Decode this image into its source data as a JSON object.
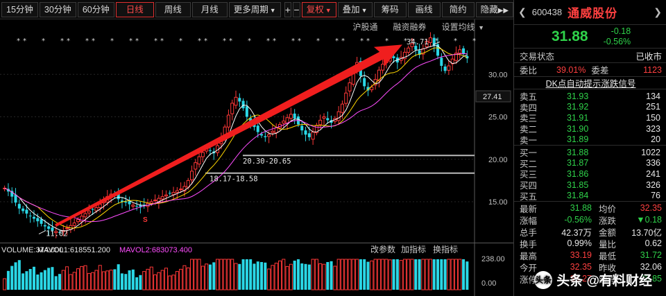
{
  "toolbar": {
    "periods": [
      "15分钟",
      "30分钟",
      "60分钟",
      "日线",
      "周线",
      "月线",
      "更多周期"
    ],
    "active_period": "日线",
    "tools": [
      "复权",
      "叠加",
      "筹码",
      "画线",
      "简约",
      "隐藏"
    ]
  },
  "subtools": [
    "沪股通",
    "融资融券",
    "设置均线"
  ],
  "chart_data": {
    "type": "candlestick",
    "y_ticks": [
      30.0,
      25.0,
      20.0,
      15.0
    ],
    "y_range": [
      11.0,
      35.0
    ],
    "current_price_label": "27.41",
    "annotations": {
      "low": "11.02",
      "high": "34.71",
      "band1": "20.30-20.65",
      "band2": "18.17-18.58"
    },
    "closes": [
      16.6,
      16.2,
      15.6,
      14.9,
      14.2,
      13.9,
      13.6,
      13.3,
      13.0,
      12.7,
      12.4,
      12.1,
      11.8,
      11.6,
      11.5,
      11.4,
      11.6,
      11.9,
      12.2,
      12.5,
      12.9,
      13.3,
      13.6,
      13.9,
      14.1,
      14.3,
      14.7,
      15.2,
      15.6,
      15.9,
      15.7,
      15.3,
      15.0,
      14.9,
      14.7,
      14.6,
      14.5,
      14.4,
      14.6,
      14.8,
      15.0,
      15.2,
      15.4,
      15.6,
      15.8,
      16.0,
      16.1,
      16.3,
      16.5,
      16.8,
      17.5,
      18.6,
      19.6,
      20.3,
      20.8,
      21.3,
      21.0,
      20.7,
      21.6,
      22.6,
      23.8,
      25.2,
      26.6,
      27.3,
      26.8,
      26.0,
      25.0,
      24.4,
      23.8,
      23.2,
      22.8,
      22.6,
      22.9,
      23.3,
      23.7,
      24.1,
      24.5,
      24.9,
      25.3,
      24.8,
      24.1,
      23.4,
      22.9,
      22.6,
      23.2,
      24.0,
      24.6,
      25.0,
      24.6,
      24.3,
      24.8,
      25.6,
      26.5,
      27.8,
      29.0,
      30.6,
      31.4,
      29.8,
      28.6,
      28.1,
      28.5,
      29.4,
      30.5,
      31.2,
      31.8,
      32.2,
      31.9,
      31.4,
      32.0,
      32.6,
      33.1,
      33.6,
      32.9,
      32.3,
      33.0,
      33.9,
      34.3,
      33.4,
      32.2,
      31.0,
      30.4,
      31.0,
      31.8,
      32.5,
      32.9,
      32.4,
      31.88
    ],
    "volume": {
      "y_ticks": [
        "238.00",
        "0.00"
      ],
      "legend": [
        "VOLUME:374.000",
        "MAVOL1:618551.200",
        "MAVOL2:683073.400"
      ],
      "right_links": [
        "改参数",
        "加指标",
        "换指标"
      ]
    }
  },
  "panel": {
    "code": "600438",
    "name": "通威股份",
    "price": "31.88",
    "change": "-0.18",
    "change_pct": "-0.56%",
    "trade_status_label": "交易状态",
    "trade_status": "已收市",
    "weibi_label": "委比",
    "weibi": "39.01%",
    "weicha_label": "委差",
    "weicha": "1123",
    "dk_label": "DK点自动提示涨跌信号",
    "asks": [
      {
        "name": "卖五",
        "price": "31.93",
        "vol": "134"
      },
      {
        "name": "卖四",
        "price": "31.92",
        "vol": "251"
      },
      {
        "name": "卖三",
        "price": "31.91",
        "vol": "150"
      },
      {
        "name": "卖二",
        "price": "31.90",
        "vol": "323"
      },
      {
        "name": "卖一",
        "price": "31.89",
        "vol": "20"
      }
    ],
    "bids": [
      {
        "name": "买一",
        "price": "31.88",
        "vol": "1022"
      },
      {
        "name": "买二",
        "price": "31.87",
        "vol": "336"
      },
      {
        "name": "买三",
        "price": "31.86",
        "vol": "241"
      },
      {
        "name": "买四",
        "price": "31.85",
        "vol": "326"
      },
      {
        "name": "买五",
        "price": "31.84",
        "vol": "76"
      }
    ],
    "stats": [
      {
        "k1": "最新",
        "v1": "31.88",
        "c1": "grn",
        "k2": "均价",
        "v2": "32.35",
        "c2": "red"
      },
      {
        "k1": "涨幅",
        "v1": "-0.56%",
        "c1": "grn",
        "k2": "涨跌",
        "v2": "▼0.18",
        "c2": "grn"
      },
      {
        "k1": "总手",
        "v1": "42.37万",
        "c1": "wht",
        "k2": "金额",
        "v2": "13.70亿",
        "c2": "wht"
      },
      {
        "k1": "换手",
        "v1": "0.99%",
        "c1": "wht",
        "k2": "量比",
        "v2": "0.62",
        "c2": "wht"
      },
      {
        "k1": "最高",
        "v1": "33.19",
        "c1": "red",
        "k2": "最低",
        "v2": "31.72",
        "c2": "grn"
      },
      {
        "k1": "今开",
        "v1": "32.35",
        "c1": "red",
        "k2": "昨收",
        "v2": "32.06",
        "c2": "wht"
      },
      {
        "k1": "涨停",
        "v1": "35.27",
        "c1": "red",
        "k2": "跌停",
        "v2": "28.85",
        "c2": "grn"
      }
    ]
  },
  "watermark": {
    "logo": "头条",
    "text": "头条 @有料财经"
  }
}
